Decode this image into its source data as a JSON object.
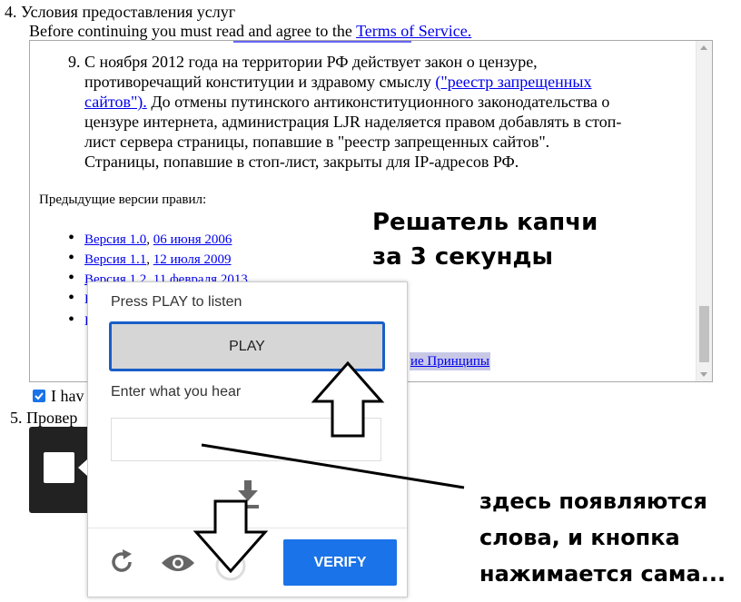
{
  "section4": {
    "heading": "4. Условия предоставления услуг",
    "intro_text": "Before continuing you must read and agree to the ",
    "intro_link": "Terms of Service."
  },
  "tos": {
    "item9_number": "9.",
    "item9_lines": [
      "С ноября 2012 года на территории РФ действует закон о цензуре,",
      "противоречащий конституции и здравому смыслу "
    ],
    "item9_link_part1": "(\"реестр запрещенных",
    "item9_link_part2": "сайтов\").",
    "item9_rest_line2": " До отмены путинского антиконституционного законодательства о",
    "item9_rest_lines": [
      "цензуре интернета, администрация LJR наделяется правом добавлять в стоп-",
      "лист сервера страницы, попавшие в \"реестр запрещенных сайтов\".",
      "Страницы, попавшие в стоп-лист, закрыты для IP-адресов РФ."
    ],
    "prev_versions_label": "Предыдущие версии правил:",
    "versions": [
      {
        "name": "Версия 1.0",
        "date": "06 июня 2006"
      },
      {
        "name": "Версия 1.1",
        "date": "12 июля 2009"
      },
      {
        "name": "Версия 1.2",
        "date": "11 февраля 2013"
      }
    ],
    "principles_link": "ие Принципы"
  },
  "agree": {
    "checked": true,
    "label": "I hav"
  },
  "section5": {
    "heading": "5. Провер"
  },
  "captcha": {
    "prompt": "Press PLAY to listen",
    "play_label": "PLAY",
    "enter_label": "Enter what you hear",
    "answer_value": "",
    "verify_label": "VERIFY"
  },
  "annotations": {
    "title_line1": "Решатель капчи",
    "title_line2": "за 3 секунды",
    "note_line1": "здесь появляются",
    "note_line2": "слова, и кнопка",
    "note_line3": "нажимается сама..."
  },
  "colors": {
    "link": "#0000ee",
    "accent": "#1a73e8",
    "play_border": "#1a5ec8"
  }
}
